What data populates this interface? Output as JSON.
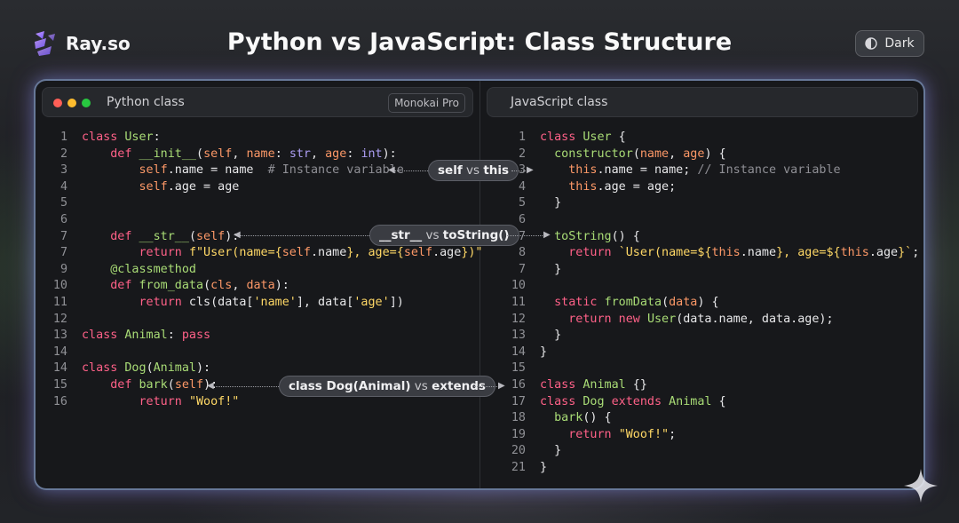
{
  "brand": {
    "name": "Ray.so",
    "logo_icon": "ray-logo-icon"
  },
  "title": "Python vs JavaScript: Class Structure",
  "theme_toggle": {
    "label": "Dark",
    "icon": "half-circle-icon"
  },
  "colors": {
    "frame_glow": "#a8c4ff",
    "keyword": "#ff6188",
    "function": "#a9dc76",
    "string": "#ffd866",
    "param": "#fc9867",
    "comment": "#8f8f95"
  },
  "python_panel": {
    "label": "Python class",
    "theme": "Monokai Pro",
    "line_numbers": [
      "1",
      "2",
      "3",
      "4",
      "5",
      "6",
      "7",
      "7",
      "9",
      "10",
      "11",
      "12",
      "13",
      "14",
      "14",
      "15",
      "16"
    ]
  },
  "js_panel": {
    "label": "JavaScript class",
    "line_numbers": [
      "1",
      "2",
      "3",
      "4",
      "5",
      "6",
      "7",
      "8",
      "7",
      "10",
      "11",
      "12",
      "13",
      "14",
      "15",
      "16",
      "17",
      "18",
      "19",
      "20",
      "21"
    ]
  },
  "annotations": [
    {
      "bold": "self",
      "vs": "vs",
      "bold2": "this"
    },
    {
      "bold": "__str__",
      "vs": "vs",
      "bold2": "toString()"
    },
    {
      "bold": "class Dog(Animal)",
      "vs": "vs",
      "bold2": "extends"
    }
  ]
}
